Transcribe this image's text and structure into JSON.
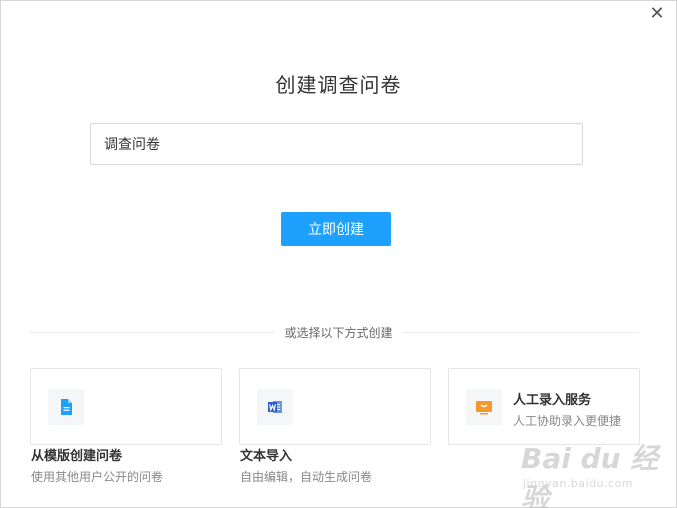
{
  "dialog": {
    "title": "创建调查问卷",
    "close_icon": "close-icon"
  },
  "form": {
    "name_value": "调查问卷",
    "create_label": "立即创建"
  },
  "divider": {
    "label": "或选择以下方式创建"
  },
  "options": [
    {
      "title": "从模版创建问卷",
      "desc": "使用其他用户公开的问卷",
      "icon": "document-icon",
      "icon_color": "#1ea0ff"
    },
    {
      "title": "文本导入",
      "desc": "自由编辑，自动生成问卷",
      "icon": "word-icon",
      "icon_color": "#2b5fc7"
    },
    {
      "title": "人工录入服务",
      "desc": "人工协助录入更便捷",
      "icon": "tv-service-icon",
      "icon_color": "#f59a2a"
    }
  ],
  "watermark": {
    "text": "Bai du 经验",
    "sub": "jingyan.baidu.com"
  }
}
